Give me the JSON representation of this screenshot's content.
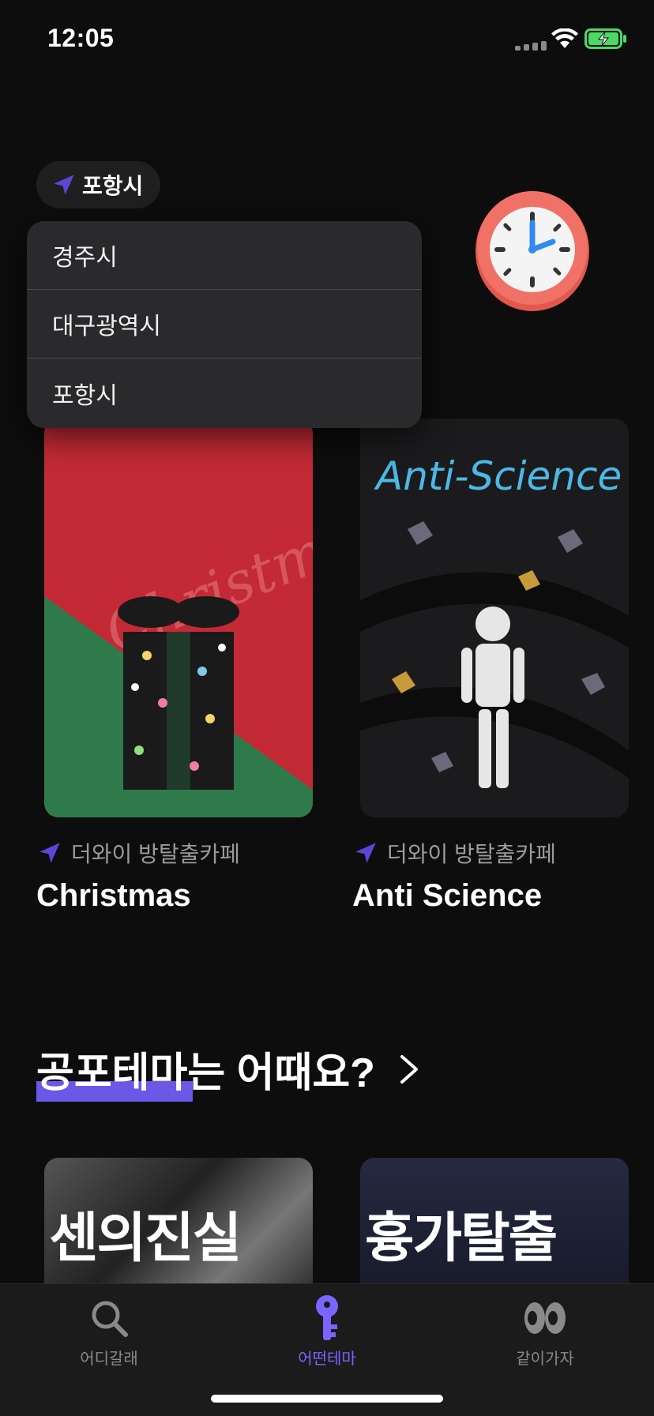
{
  "status_bar": {
    "time": "12:05"
  },
  "location": {
    "current": "포항시"
  },
  "dropdown": {
    "options": [
      "경주시",
      "대구광역시",
      "포항시"
    ]
  },
  "themes": [
    {
      "cafe": "더와이 방탈출카페",
      "title": "Christmas",
      "poster_text": "Christmas"
    },
    {
      "cafe": "더와이 방탈출카페",
      "title": "Anti Science",
      "poster_text": "Anti-Science"
    }
  ],
  "horror_section": {
    "title": "공포테마는 어때요?",
    "posters": [
      {
        "text": "센의진실"
      },
      {
        "text": "흉가탈출"
      }
    ]
  },
  "tabbar": {
    "items": [
      {
        "label": "어디갈래",
        "icon": "search-icon"
      },
      {
        "label": "어떤테마",
        "icon": "key-icon",
        "active": true
      },
      {
        "label": "같이가자",
        "icon": "eyes-icon"
      }
    ]
  },
  "colors": {
    "accent": "#6b58e6",
    "accent_text": "#7b64ff",
    "background": "#0d0d0d"
  }
}
